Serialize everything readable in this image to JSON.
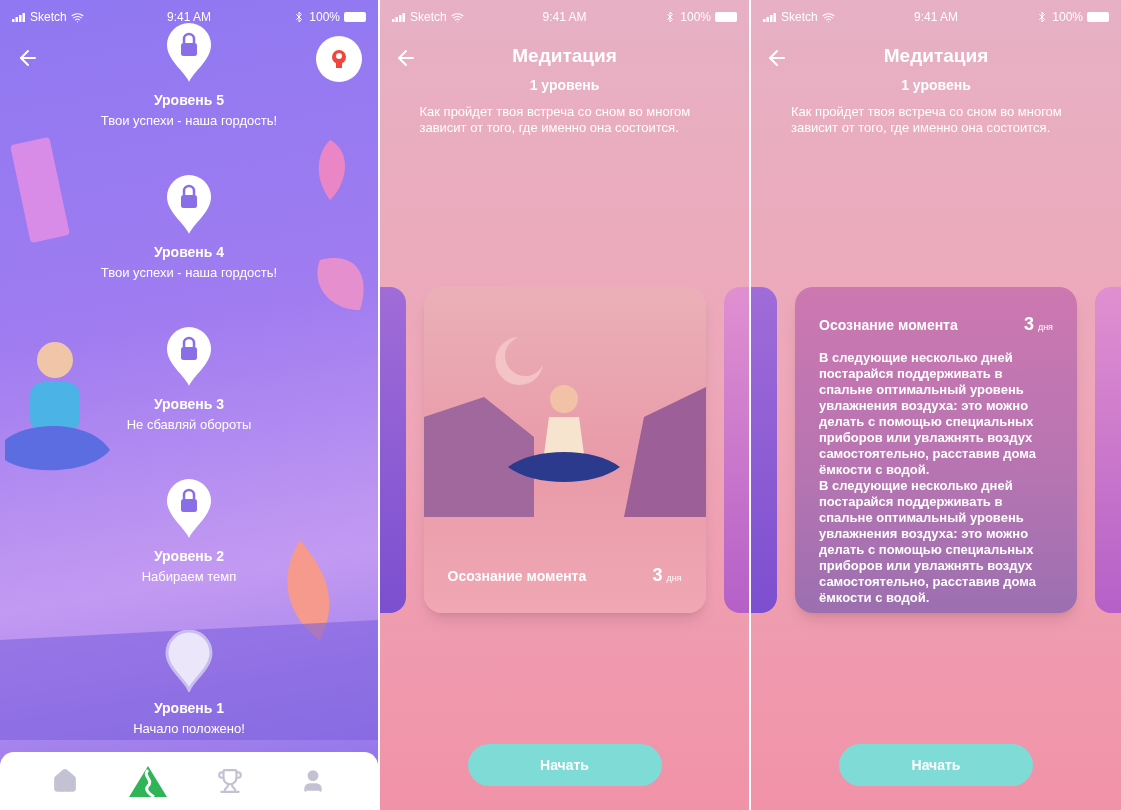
{
  "screens": [
    {
      "kind": "levels",
      "status_bar": {
        "carrier": "Sketch",
        "time": "9:41 AM",
        "battery": "100%"
      },
      "levels": [
        {
          "title": "Уровень 5",
          "subtitle": "Твои успехи - наша гордость!",
          "locked": true
        },
        {
          "title": "Уровень 4",
          "subtitle": "Твои успехи - наша гордость!",
          "locked": true
        },
        {
          "title": "Уровень 3",
          "subtitle": "Не сбавляй обороты",
          "locked": true
        },
        {
          "title": "Уровень 2",
          "subtitle": "Набираем темп",
          "locked": true
        },
        {
          "title": "Уровень 1",
          "subtitle": "Начало положено!",
          "locked": false
        }
      ],
      "tabs": [
        {
          "kind": "home",
          "selected": false
        },
        {
          "kind": "path",
          "selected": true
        },
        {
          "kind": "trophy",
          "selected": false
        },
        {
          "kind": "profile",
          "selected": false
        }
      ]
    },
    {
      "kind": "course",
      "status_bar": {
        "carrier": "Sketch",
        "time": "9:41 AM",
        "battery": "100%"
      },
      "title": "Медитация",
      "level": "1 уровень",
      "description": "Как пройдет твоя встреча со сном во многом зависит от того, где именно она состоится.",
      "card": {
        "kind": "illustration",
        "title": "Осознание момента",
        "count": "3",
        "unit": "дня"
      },
      "button": "Начать"
    },
    {
      "kind": "course",
      "status_bar": {
        "carrier": "Sketch",
        "time": "9:41 AM",
        "battery": "100%"
      },
      "title": "Медитация",
      "level": "1 уровень",
      "description": "Как пройдет твоя встреча со сном во многом зависит от того, где именно она состоится.",
      "card": {
        "kind": "text",
        "title": "Осознание момента",
        "count": "3",
        "unit": "дня",
        "body": [
          "В следующие несколько дней постарайся поддерживать в спальне оптимальный уровень увлажнения воздуха: это можно делать с помощью специальных приборов или увлажнять воздух самостоятельно, расставив дома ёмкости с водой.",
          "В следующие несколько дней постарайся поддерживать в спальне оптимальный уровень увлажнения воздуха: это можно делать с помощью специальных приборов или увлажнять воздух самостоятельно, расставив дома ёмкости с водой."
        ]
      },
      "button": "Начать"
    }
  ]
}
